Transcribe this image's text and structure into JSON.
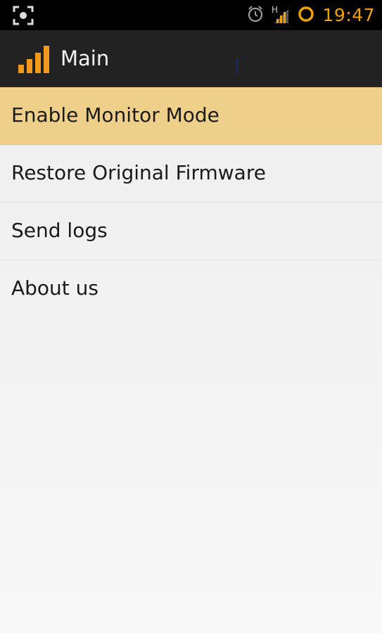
{
  "status_bar": {
    "time": "19:47",
    "network_type": "H",
    "icons": [
      "screenshot-icon",
      "alarm-icon",
      "signal-icon",
      "sync-icon"
    ],
    "clock_color": "#f0a000"
  },
  "action_bar": {
    "title": "Main",
    "app_icon": "signal-bars-icon",
    "icon_color": "#f39a1e",
    "background": "#222222"
  },
  "menu": {
    "items": [
      {
        "label": "Enable Monitor Mode",
        "selected": true
      },
      {
        "label": "Restore Original Firmware",
        "selected": false
      },
      {
        "label": "Send logs",
        "selected": false
      },
      {
        "label": "About us",
        "selected": false
      }
    ],
    "selected_color": "#efd08a"
  }
}
